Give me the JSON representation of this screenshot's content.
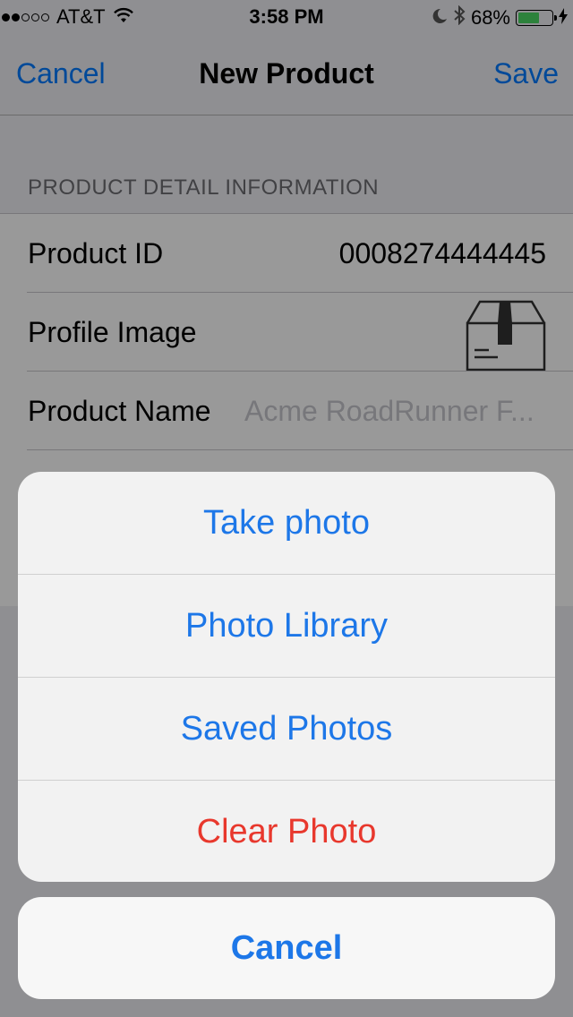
{
  "status_bar": {
    "carrier": "AT&T",
    "time": "3:58 PM",
    "battery": "68%",
    "battery_level": 0.68,
    "signal_bars": 2,
    "signal_total": 5
  },
  "nav": {
    "cancel_label": "Cancel",
    "title": "New Product",
    "save_label": "Save"
  },
  "section_header": "PRODUCT DETAIL INFORMATION",
  "rows": [
    {
      "label": "Product ID",
      "value": "0008274444445"
    },
    {
      "label": "Profile Image",
      "icon": "package-box-icon"
    },
    {
      "label": "Product Name",
      "placeholder": "Acme RoadRunner F..."
    }
  ],
  "action_sheet": {
    "items": [
      {
        "label": "Take photo"
      },
      {
        "label": "Photo Library"
      },
      {
        "label": "Saved Photos"
      },
      {
        "label": "Clear Photo",
        "style": "destructive"
      }
    ],
    "cancel_label": "Cancel"
  },
  "colors": {
    "accent": "#007aff",
    "sheet_text": "#1d77e8",
    "destructive": "#e8382d"
  }
}
